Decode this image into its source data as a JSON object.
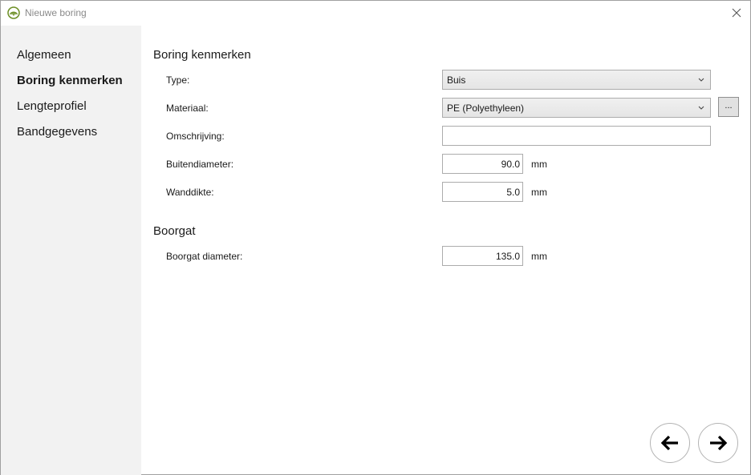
{
  "window": {
    "title": "Nieuwe boring"
  },
  "sidebar": {
    "items": [
      {
        "label": "Algemeen",
        "active": false
      },
      {
        "label": "Boring kenmerken",
        "active": true
      },
      {
        "label": "Lengteprofiel",
        "active": false
      },
      {
        "label": "Bandgegevens",
        "active": false
      }
    ]
  },
  "boring": {
    "section_title": "Boring kenmerken",
    "type": {
      "label": "Type:",
      "value": "Buis"
    },
    "materiaal": {
      "label": "Materiaal:",
      "value": "PE (Polyethyleen)",
      "browse_label": "..."
    },
    "omschrijving": {
      "label": "Omschrijving:",
      "value": ""
    },
    "buitendiameter": {
      "label": "Buitendiameter:",
      "value": "90.0",
      "unit": "mm"
    },
    "wanddikte": {
      "label": "Wanddikte:",
      "value": "5.0",
      "unit": "mm"
    }
  },
  "boorgat": {
    "section_title": "Boorgat",
    "diameter": {
      "label": "Boorgat diameter:",
      "value": "135.0",
      "unit": "mm"
    }
  },
  "navigation": {
    "back_icon": "arrow-left-icon",
    "next_icon": "arrow-right-icon"
  },
  "colors": {
    "sidebar_bg": "#f2f2f2",
    "app_icon": "#6b8e23"
  }
}
